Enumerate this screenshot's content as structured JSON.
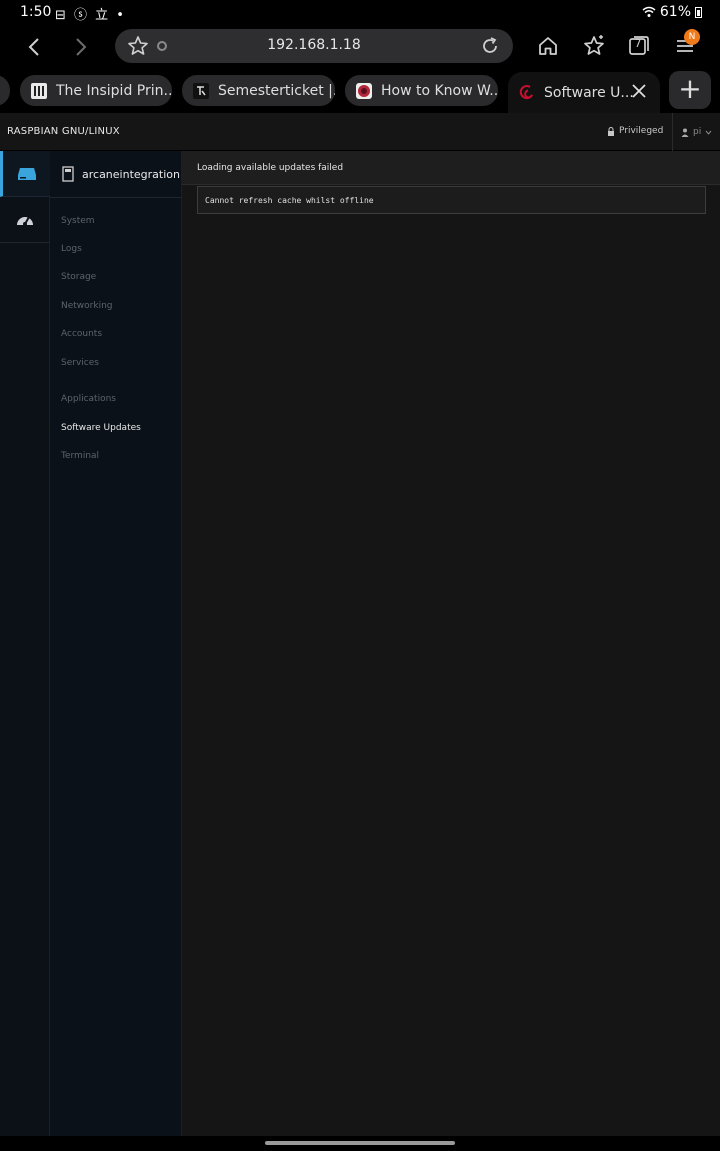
{
  "status_bar": {
    "time": "1:50",
    "notification_icons": "⊟ ⓢ 立 •",
    "battery_text": "61%"
  },
  "browser": {
    "url": "192.168.1.18",
    "tabs_count": "7",
    "menu_badge": "N",
    "new_tab_label": "+",
    "tabs": [
      {
        "title": "The Insipid Prin..."
      },
      {
        "title": "Semesterticket |..."
      },
      {
        "title": "How to Know W..."
      },
      {
        "title": "Software U..."
      }
    ]
  },
  "cockpit": {
    "os_name": "RASPBIAN GNU/LINUX",
    "privileged_label": "Privileged",
    "user_label": "pi",
    "host_name": "arcaneintegration",
    "menu": [
      {
        "label": "System",
        "active": false
      },
      {
        "label": "Logs",
        "active": false
      },
      {
        "label": "Storage",
        "active": false
      },
      {
        "label": "Networking",
        "active": false
      },
      {
        "label": "Accounts",
        "active": false
      },
      {
        "label": "Services",
        "active": false
      },
      {
        "label": "Applications",
        "active": false
      },
      {
        "label": "Software Updates",
        "active": true
      },
      {
        "label": "Terminal",
        "active": false
      }
    ],
    "error_title": "Loading available updates failed",
    "error_message": "Cannot refresh cache whilst offline"
  },
  "colors": {
    "accent": "#39a5dc",
    "badge": "#f07a1a"
  }
}
